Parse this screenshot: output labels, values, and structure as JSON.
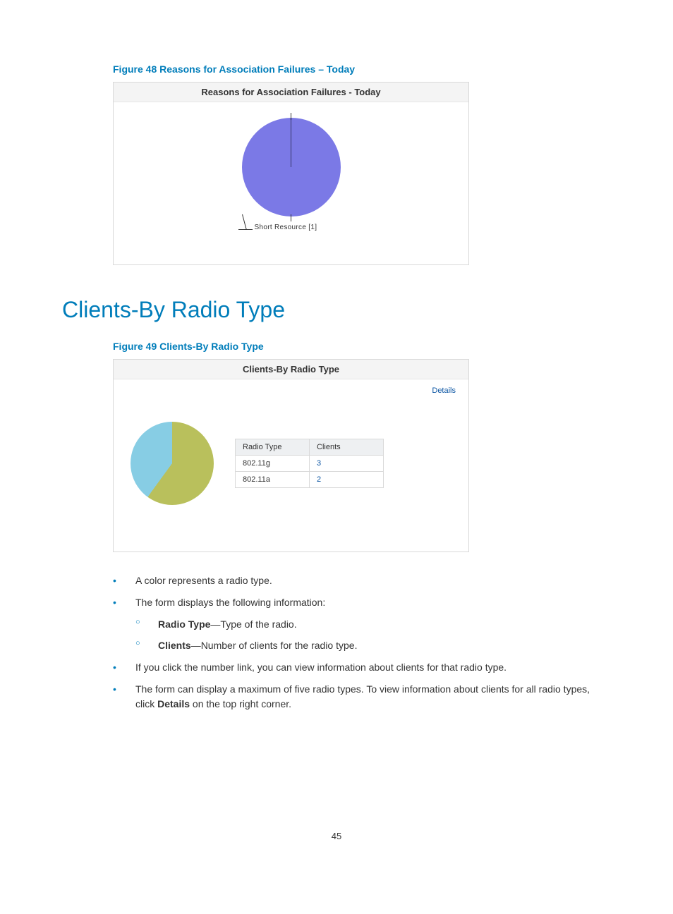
{
  "figure48": {
    "caption": "Figure 48 Reasons for Association Failures – Today",
    "panel_title": "Reasons for Association Failures - Today",
    "slice_label": "Short Resource [1]"
  },
  "section_heading": "Clients-By Radio Type",
  "figure49": {
    "caption": "Figure 49 Clients-By Radio Type",
    "panel_title": "Clients-By Radio Type",
    "details_label": "Details",
    "table": {
      "headers": {
        "col1": "Radio Type",
        "col2": "Clients"
      },
      "rows": [
        {
          "type": "802.11g",
          "clients": "3"
        },
        {
          "type": "802.11a",
          "clients": "2"
        }
      ]
    }
  },
  "bullets": {
    "b1": "A color represents a radio type.",
    "b2": "The form displays the following information:",
    "sub1_bold": "Radio Type",
    "sub1_rest": "—Type of the radio.",
    "sub2_bold": "Clients",
    "sub2_rest": "—Number of clients for the radio type.",
    "b3": "If you click the number link, you can view information about clients for that radio type.",
    "b4a": "The form can display a maximum of five radio types. To view information about clients for all radio types, click ",
    "b4_bold": "Details",
    "b4b": " on the top right corner."
  },
  "page_number": "45",
  "chart_data": [
    {
      "type": "pie",
      "title": "Reasons for Association Failures - Today",
      "categories": [
        "Short Resource"
      ],
      "values": [
        1
      ]
    },
    {
      "type": "pie",
      "title": "Clients-By Radio Type",
      "categories": [
        "802.11g",
        "802.11a"
      ],
      "values": [
        3,
        2
      ]
    }
  ]
}
